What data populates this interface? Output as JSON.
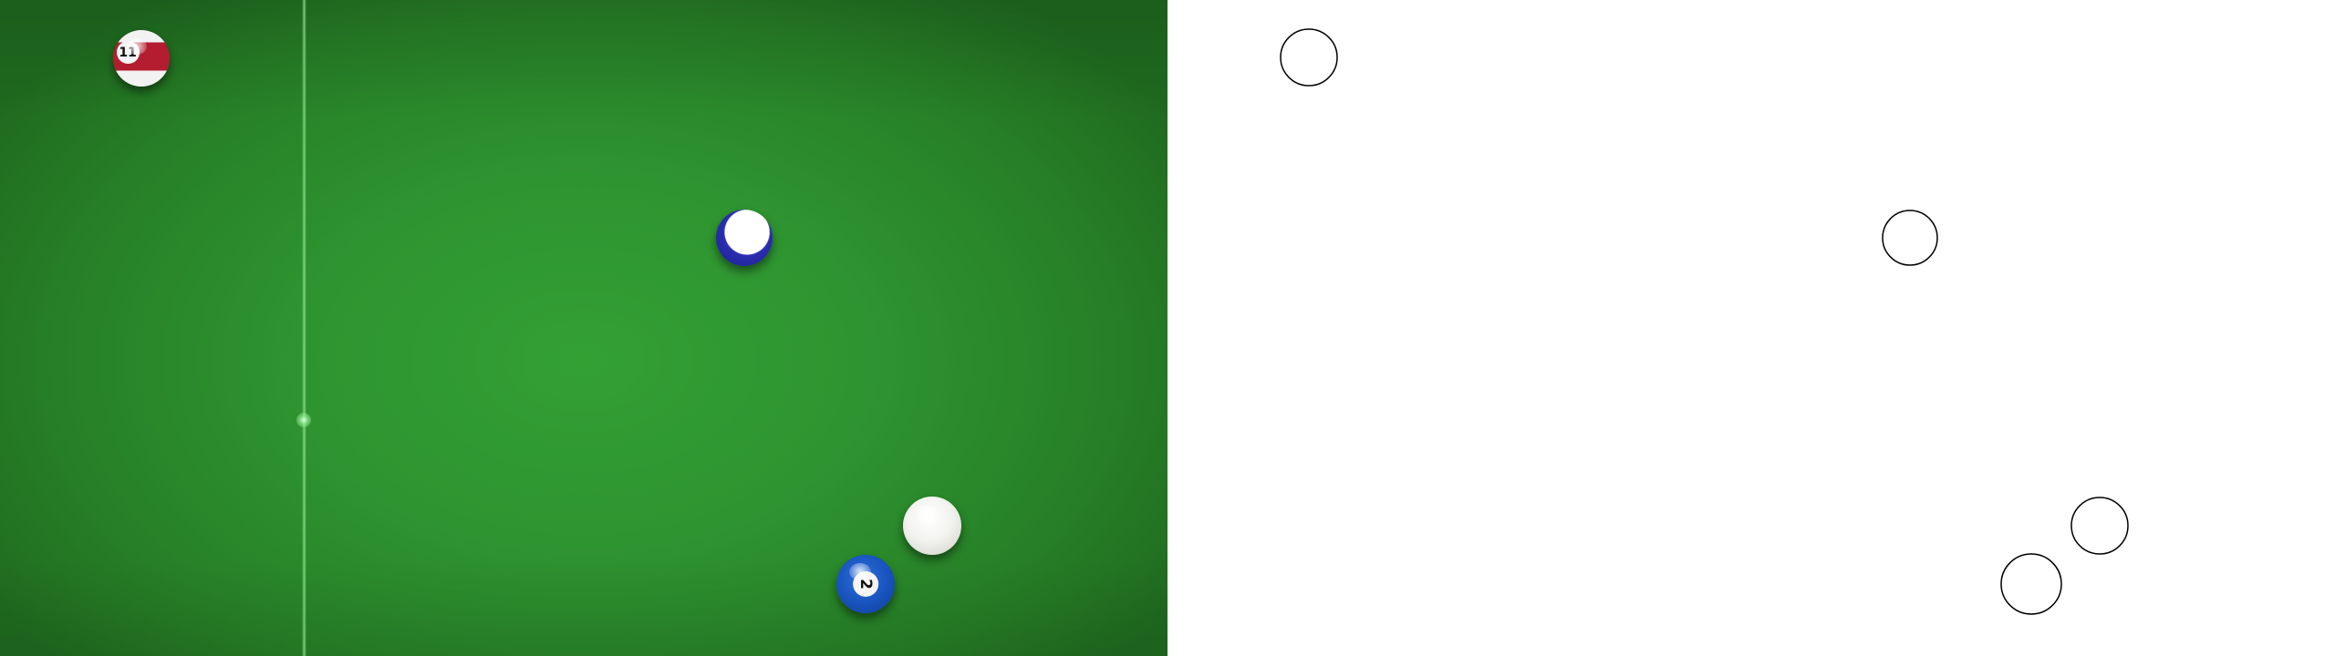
{
  "table": {
    "felt_color": "#2e9430",
    "balls": [
      {
        "id": "ball-11",
        "number": "11",
        "style": "stripe",
        "color": "#b41c30"
      },
      {
        "id": "ball-10",
        "number": "",
        "style": "stripe",
        "color": "#2b2fb0"
      },
      {
        "id": "cue-ball",
        "number": "",
        "style": "cue",
        "color": "#f3f3f0"
      },
      {
        "id": "ball-2",
        "number": "2",
        "style": "solid",
        "color": "#1a55c0"
      }
    ]
  },
  "outline": {
    "stroke_color": "#000000",
    "ball_count": 4
  }
}
